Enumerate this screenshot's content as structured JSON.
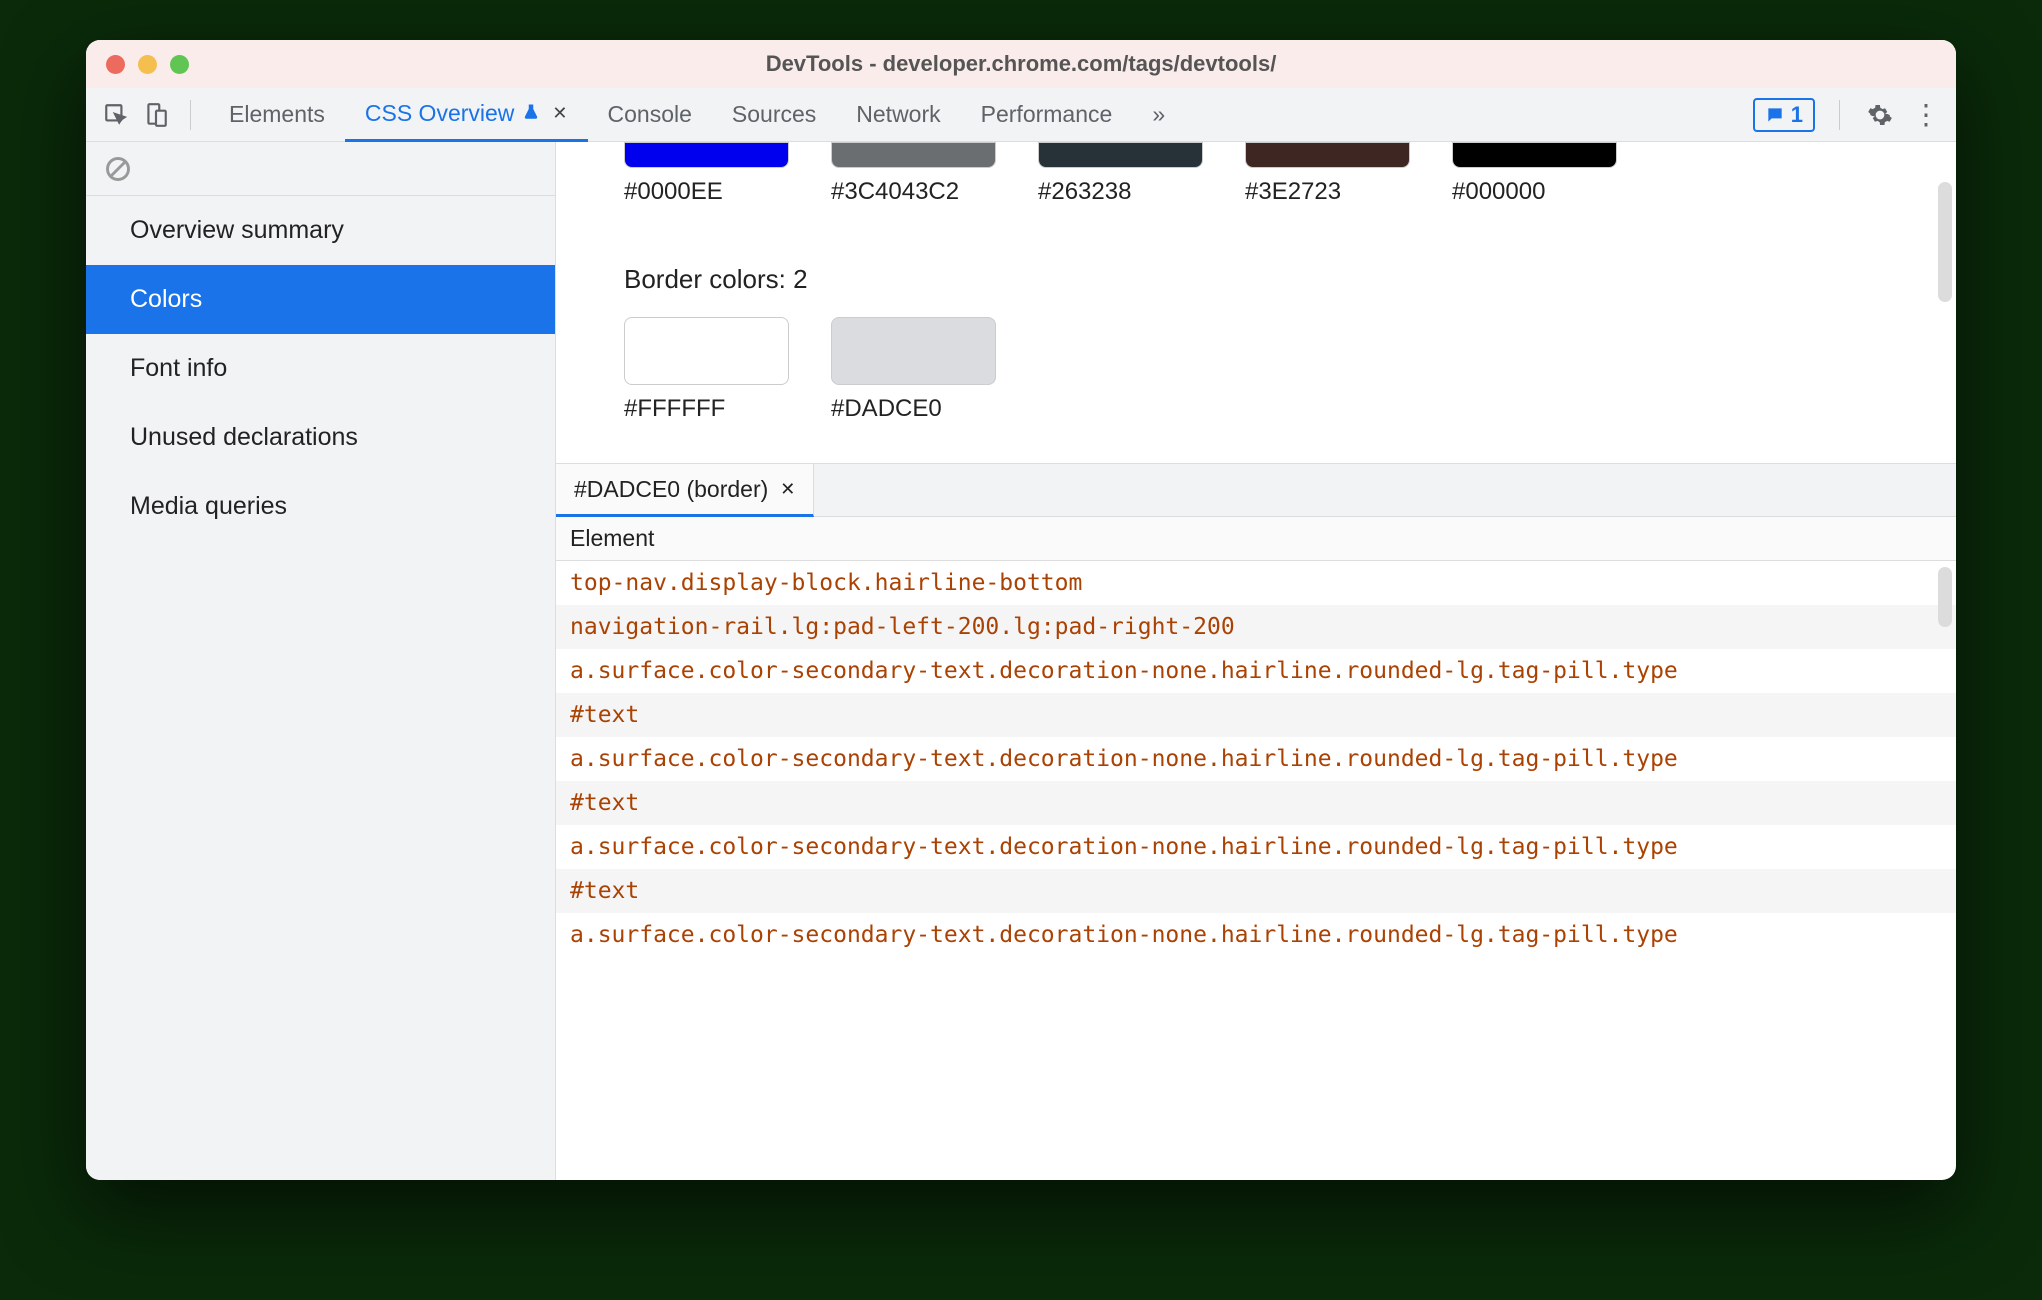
{
  "window": {
    "title": "DevTools - developer.chrome.com/tags/devtools/"
  },
  "tabs": {
    "elements": "Elements",
    "css_overview": "CSS Overview",
    "console": "Console",
    "sources": "Sources",
    "network": "Network",
    "performance": "Performance",
    "more": "»"
  },
  "msg_count": "1",
  "sidebar": {
    "items": [
      "Overview summary",
      "Colors",
      "Font info",
      "Unused declarations",
      "Media queries"
    ],
    "selected_index": 1
  },
  "colors_top": [
    {
      "hex": "#0000EE",
      "value": "#0000EE"
    },
    {
      "hex": "#3C4043C2",
      "value": "rgba(60,64,67,0.76)"
    },
    {
      "hex": "#263238",
      "value": "#263238"
    },
    {
      "hex": "#3E2723",
      "value": "#3E2723"
    },
    {
      "hex": "#000000",
      "value": "#000000"
    }
  ],
  "border_title": "Border colors: 2",
  "border_colors": [
    {
      "hex": "#FFFFFF",
      "value": "#FFFFFF"
    },
    {
      "hex": "#DADCE0",
      "value": "#DADCE0"
    }
  ],
  "detail_tab": "#DADCE0 (border)",
  "table_header": "Element",
  "rows": [
    "top-nav.display-block.hairline-bottom",
    "navigation-rail.lg:pad-left-200.lg:pad-right-200",
    "a.surface.color-secondary-text.decoration-none.hairline.rounded-lg.tag-pill.type",
    "#text",
    "a.surface.color-secondary-text.decoration-none.hairline.rounded-lg.tag-pill.type",
    "#text",
    "a.surface.color-secondary-text.decoration-none.hairline.rounded-lg.tag-pill.type",
    "#text",
    "a.surface.color-secondary-text.decoration-none.hairline.rounded-lg.tag-pill.type"
  ]
}
